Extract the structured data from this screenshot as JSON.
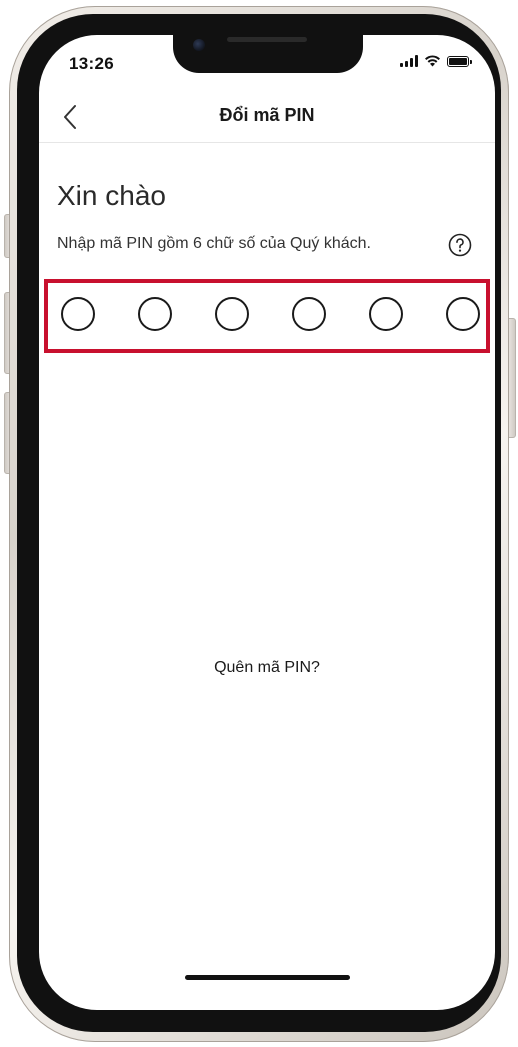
{
  "status_bar": {
    "time": "13:26",
    "icons": [
      "signal-icon",
      "wifi-icon",
      "battery-icon"
    ]
  },
  "header": {
    "back_icon": "chevron-left-icon",
    "title": "Đổi mã PIN"
  },
  "main": {
    "greeting": "Xin chào",
    "instruction": "Nhập mã PIN gồm 6 chữ số của Quý khách.",
    "help_icon": "question-circle-icon",
    "pin_length": 6,
    "pin_filled": 0,
    "forgot_pin_label": "Quên mã PIN?"
  },
  "colors": {
    "highlight_border": "#c8102e",
    "text_primary": "#1a1a1a",
    "background": "#ffffff"
  }
}
